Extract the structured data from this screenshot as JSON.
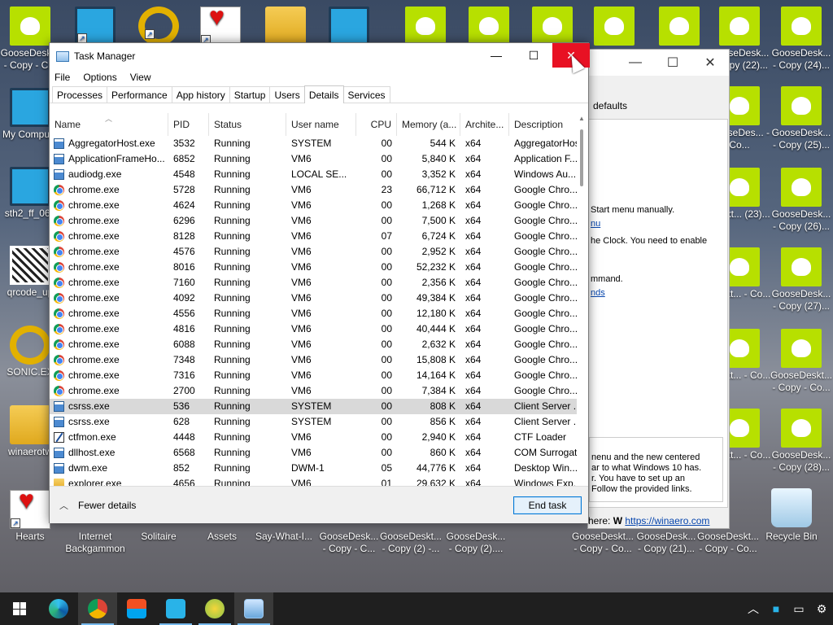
{
  "desktop": {
    "icons_left": [
      {
        "label": "GooseDesk... - Copy - C...",
        "type": "goose"
      },
      {
        "label": "My Compu...",
        "type": "monitor"
      },
      {
        "label": "sth2_ff_067",
        "type": "game"
      },
      {
        "label": "qrcode_up",
        "type": "qr"
      },
      {
        "label": "SONIC.EX",
        "type": "ring"
      },
      {
        "label": "winaerotw",
        "type": "folder"
      },
      {
        "label": "Hearts",
        "type": "heart"
      }
    ],
    "icons_bottom": [
      {
        "label": "Internet Backgammon"
      },
      {
        "label": "Solitaire"
      },
      {
        "label": "Assets"
      },
      {
        "label": "Say-What-I..."
      },
      {
        "label": "GooseDesk... - Copy - C..."
      },
      {
        "label": "GooseDeskt... - Copy (2) -..."
      },
      {
        "label": "GooseDesk... - Copy (2)...."
      },
      {
        "label": "GooseDeskt... - Copy - Co..."
      },
      {
        "label": "GooseDesk... - Copy (21)..."
      },
      {
        "label": "GooseDeskt... - Copy - Co..."
      },
      {
        "label": "Recycle Bin"
      }
    ],
    "icons_right": [
      {
        "label": "GooseDesk... - Copy (22)..."
      },
      {
        "label": "GooseDesk... - Copy (24)..."
      },
      {
        "label": "GooseDes... - Co..."
      },
      {
        "label": "GooseDesk... - Copy (25)..."
      },
      {
        "label": "Deskt... (23)..."
      },
      {
        "label": "GooseDesk... - Copy (26)..."
      },
      {
        "label": "Deskt... - Co..."
      },
      {
        "label": "GooseDesk... - Copy (27)..."
      },
      {
        "label": "Deskt... - Co..."
      },
      {
        "label": "GooseDeskt... - Copy - Co..."
      },
      {
        "label": "Deskt... - Co..."
      },
      {
        "label": "GooseDesk... - Copy (28)..."
      }
    ]
  },
  "bg_window": {
    "header": "defaults",
    "line1": "Start menu manually.",
    "link1": "nu",
    "line2": "he Clock. You need to enable",
    "line3": "mmand.",
    "link2": "nds",
    "box_lines": [
      "nenu and the new centered",
      "ar to what Windows 10 has.",
      "r. You have to set up an",
      "Follow the provided links."
    ],
    "footer_prefix": "here:",
    "footer_link": "https://winaero.com"
  },
  "task_manager": {
    "title": "Task Manager",
    "menu": [
      "File",
      "Options",
      "View"
    ],
    "tabs": [
      "Processes",
      "Performance",
      "App history",
      "Startup",
      "Users",
      "Details",
      "Services"
    ],
    "active_tab": "Details",
    "columns": [
      "Name",
      "PID",
      "Status",
      "User name",
      "CPU",
      "Memory (a...",
      "Archite...",
      "Description"
    ],
    "rows": [
      {
        "icon": "app",
        "name": "AggregatorHost.exe",
        "pid": "3532",
        "status": "Running",
        "user": "SYSTEM",
        "cpu": "00",
        "mem": "544 K",
        "arch": "x64",
        "desc": "AggregatorHost"
      },
      {
        "icon": "app",
        "name": "ApplicationFrameHo...",
        "pid": "6852",
        "status": "Running",
        "user": "VM6",
        "cpu": "00",
        "mem": "5,840 K",
        "arch": "x64",
        "desc": "Application F..."
      },
      {
        "icon": "app",
        "name": "audiodg.exe",
        "pid": "4548",
        "status": "Running",
        "user": "LOCAL SE...",
        "cpu": "00",
        "mem": "3,352 K",
        "arch": "x64",
        "desc": "Windows Au..."
      },
      {
        "icon": "chrome",
        "name": "chrome.exe",
        "pid": "5728",
        "status": "Running",
        "user": "VM6",
        "cpu": "23",
        "mem": "66,712 K",
        "arch": "x64",
        "desc": "Google Chro..."
      },
      {
        "icon": "chrome",
        "name": "chrome.exe",
        "pid": "4624",
        "status": "Running",
        "user": "VM6",
        "cpu": "00",
        "mem": "1,268 K",
        "arch": "x64",
        "desc": "Google Chro..."
      },
      {
        "icon": "chrome",
        "name": "chrome.exe",
        "pid": "6296",
        "status": "Running",
        "user": "VM6",
        "cpu": "00",
        "mem": "7,500 K",
        "arch": "x64",
        "desc": "Google Chro..."
      },
      {
        "icon": "chrome",
        "name": "chrome.exe",
        "pid": "8128",
        "status": "Running",
        "user": "VM6",
        "cpu": "07",
        "mem": "6,724 K",
        "arch": "x64",
        "desc": "Google Chro..."
      },
      {
        "icon": "chrome",
        "name": "chrome.exe",
        "pid": "4576",
        "status": "Running",
        "user": "VM6",
        "cpu": "00",
        "mem": "2,952 K",
        "arch": "x64",
        "desc": "Google Chro..."
      },
      {
        "icon": "chrome",
        "name": "chrome.exe",
        "pid": "8016",
        "status": "Running",
        "user": "VM6",
        "cpu": "00",
        "mem": "52,232 K",
        "arch": "x64",
        "desc": "Google Chro..."
      },
      {
        "icon": "chrome",
        "name": "chrome.exe",
        "pid": "7160",
        "status": "Running",
        "user": "VM6",
        "cpu": "00",
        "mem": "2,356 K",
        "arch": "x64",
        "desc": "Google Chro..."
      },
      {
        "icon": "chrome",
        "name": "chrome.exe",
        "pid": "4092",
        "status": "Running",
        "user": "VM6",
        "cpu": "00",
        "mem": "49,384 K",
        "arch": "x64",
        "desc": "Google Chro..."
      },
      {
        "icon": "chrome",
        "name": "chrome.exe",
        "pid": "4556",
        "status": "Running",
        "user": "VM6",
        "cpu": "00",
        "mem": "12,180 K",
        "arch": "x64",
        "desc": "Google Chro..."
      },
      {
        "icon": "chrome",
        "name": "chrome.exe",
        "pid": "4816",
        "status": "Running",
        "user": "VM6",
        "cpu": "00",
        "mem": "40,444 K",
        "arch": "x64",
        "desc": "Google Chro..."
      },
      {
        "icon": "chrome",
        "name": "chrome.exe",
        "pid": "6088",
        "status": "Running",
        "user": "VM6",
        "cpu": "00",
        "mem": "2,632 K",
        "arch": "x64",
        "desc": "Google Chro..."
      },
      {
        "icon": "chrome",
        "name": "chrome.exe",
        "pid": "7348",
        "status": "Running",
        "user": "VM6",
        "cpu": "00",
        "mem": "15,808 K",
        "arch": "x64",
        "desc": "Google Chro..."
      },
      {
        "icon": "chrome",
        "name": "chrome.exe",
        "pid": "7316",
        "status": "Running",
        "user": "VM6",
        "cpu": "00",
        "mem": "14,164 K",
        "arch": "x64",
        "desc": "Google Chro..."
      },
      {
        "icon": "chrome",
        "name": "chrome.exe",
        "pid": "2700",
        "status": "Running",
        "user": "VM6",
        "cpu": "00",
        "mem": "7,384 K",
        "arch": "x64",
        "desc": "Google Chro..."
      },
      {
        "icon": "app",
        "name": "csrss.exe",
        "pid": "536",
        "status": "Running",
        "user": "SYSTEM",
        "cpu": "00",
        "mem": "808 K",
        "arch": "x64",
        "desc": "Client Server ...",
        "selected": true
      },
      {
        "icon": "app",
        "name": "csrss.exe",
        "pid": "628",
        "status": "Running",
        "user": "SYSTEM",
        "cpu": "00",
        "mem": "856 K",
        "arch": "x64",
        "desc": "Client Server ..."
      },
      {
        "icon": "pen",
        "name": "ctfmon.exe",
        "pid": "4448",
        "status": "Running",
        "user": "VM6",
        "cpu": "00",
        "mem": "2,940 K",
        "arch": "x64",
        "desc": "CTF Loader"
      },
      {
        "icon": "app",
        "name": "dllhost.exe",
        "pid": "6568",
        "status": "Running",
        "user": "VM6",
        "cpu": "00",
        "mem": "860 K",
        "arch": "x64",
        "desc": "COM Surrogate"
      },
      {
        "icon": "app",
        "name": "dwm.exe",
        "pid": "852",
        "status": "Running",
        "user": "DWM-1",
        "cpu": "05",
        "mem": "44,776 K",
        "arch": "x64",
        "desc": "Desktop Win..."
      },
      {
        "icon": "folder",
        "name": "explorer.exe",
        "pid": "4656",
        "status": "Running",
        "user": "VM6",
        "cpu": "01",
        "mem": "29,632 K",
        "arch": "x64",
        "desc": "Windows Exp..."
      }
    ],
    "fewer_details": "Fewer details",
    "end_task": "End task"
  },
  "taskbar": {
    "items": [
      "start-icon",
      "edge-icon",
      "chrome-icon",
      "store-icon",
      "winaero-tweaker-icon",
      "goose-desktop-icon",
      "task-manager-icon"
    ],
    "colors": {
      "accent": "#76b9ed",
      "close": "#e81123",
      "goose": "#b7e000"
    }
  }
}
